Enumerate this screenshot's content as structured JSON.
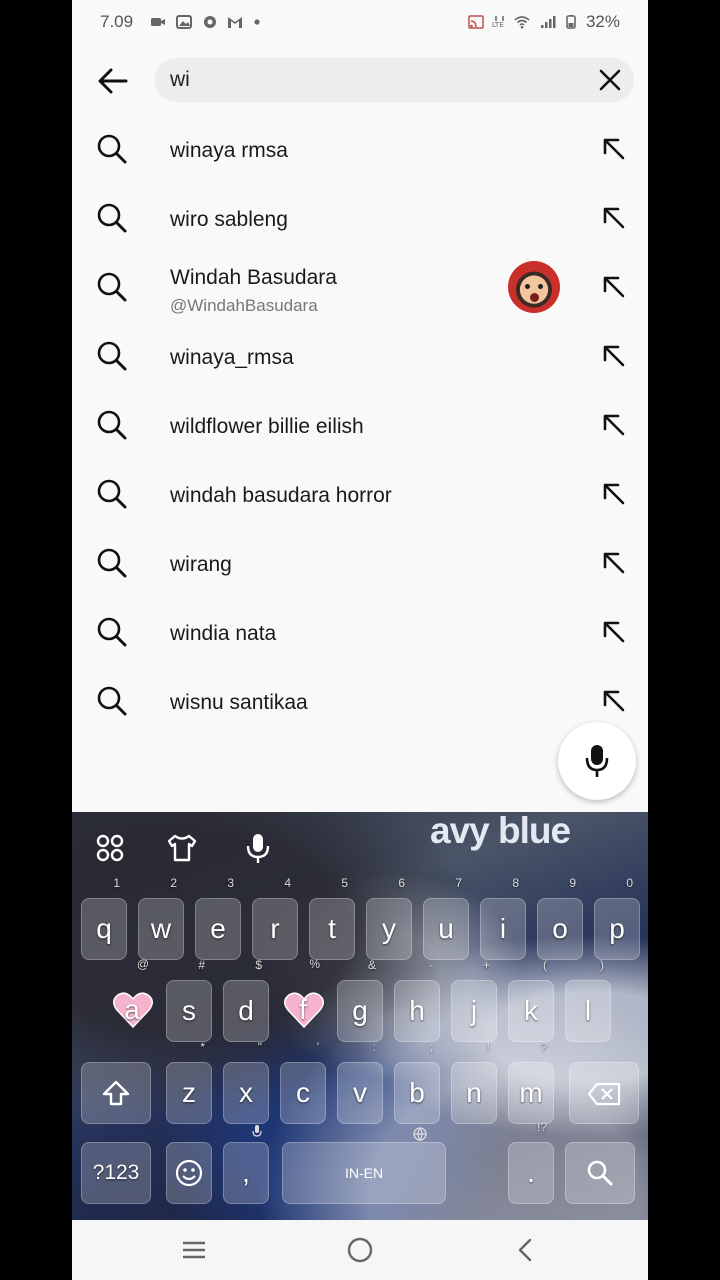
{
  "status_bar": {
    "time": "7.09",
    "battery": "32%"
  },
  "search": {
    "query": "wi"
  },
  "suggestions": [
    {
      "label": "winaya rmsa"
    },
    {
      "label": "wiro sableng"
    },
    {
      "label": "Windah Basudara",
      "handle": "@WindahBasudara"
    },
    {
      "label": "winaya_rmsa"
    },
    {
      "label": "wildflower billie eilish"
    },
    {
      "label": "windah basudara horror"
    },
    {
      "label": "wirang"
    },
    {
      "label": "windia nata"
    },
    {
      "label": "wisnu santikaa"
    }
  ],
  "keyboard": {
    "banner": "avy blue",
    "row1": [
      {
        "k": "q",
        "h": "1"
      },
      {
        "k": "w",
        "h": "2"
      },
      {
        "k": "e",
        "h": "3"
      },
      {
        "k": "r",
        "h": "4"
      },
      {
        "k": "t",
        "h": "5"
      },
      {
        "k": "y",
        "h": "6"
      },
      {
        "k": "u",
        "h": "7"
      },
      {
        "k": "i",
        "h": "8"
      },
      {
        "k": "o",
        "h": "9"
      },
      {
        "k": "p",
        "h": "0"
      }
    ],
    "row2": [
      {
        "k": "a",
        "h": "@"
      },
      {
        "k": "s",
        "h": "#"
      },
      {
        "k": "d",
        "h": "$"
      },
      {
        "k": "f",
        "h": "%"
      },
      {
        "k": "g",
        "h": "&"
      },
      {
        "k": "h",
        "h": "-"
      },
      {
        "k": "j",
        "h": "+"
      },
      {
        "k": "k",
        "h": "("
      },
      {
        "k": "l",
        "h": ")"
      }
    ],
    "row3": [
      {
        "k": "z",
        "h": "*"
      },
      {
        "k": "x",
        "h": "\""
      },
      {
        "k": "c",
        "h": "'"
      },
      {
        "k": "v",
        "h": ":"
      },
      {
        "k": "b",
        "h": ";"
      },
      {
        "k": "n",
        "h": "!"
      },
      {
        "k": "m",
        "h": "?"
      }
    ],
    "symbols_key": "?123",
    "comma_key": ",",
    "space_label": "IN-EN",
    "period_key": ".",
    "period_hint": "!?"
  },
  "colors": {
    "screen_bg": "#f9f9f9",
    "text": "#1a1a1a",
    "subtext": "#777777"
  },
  "icons": [
    "search-icon",
    "fill-arrow-icon",
    "back-arrow-icon",
    "close-icon",
    "microphone-icon",
    "emoji-icon",
    "globe-icon"
  ]
}
